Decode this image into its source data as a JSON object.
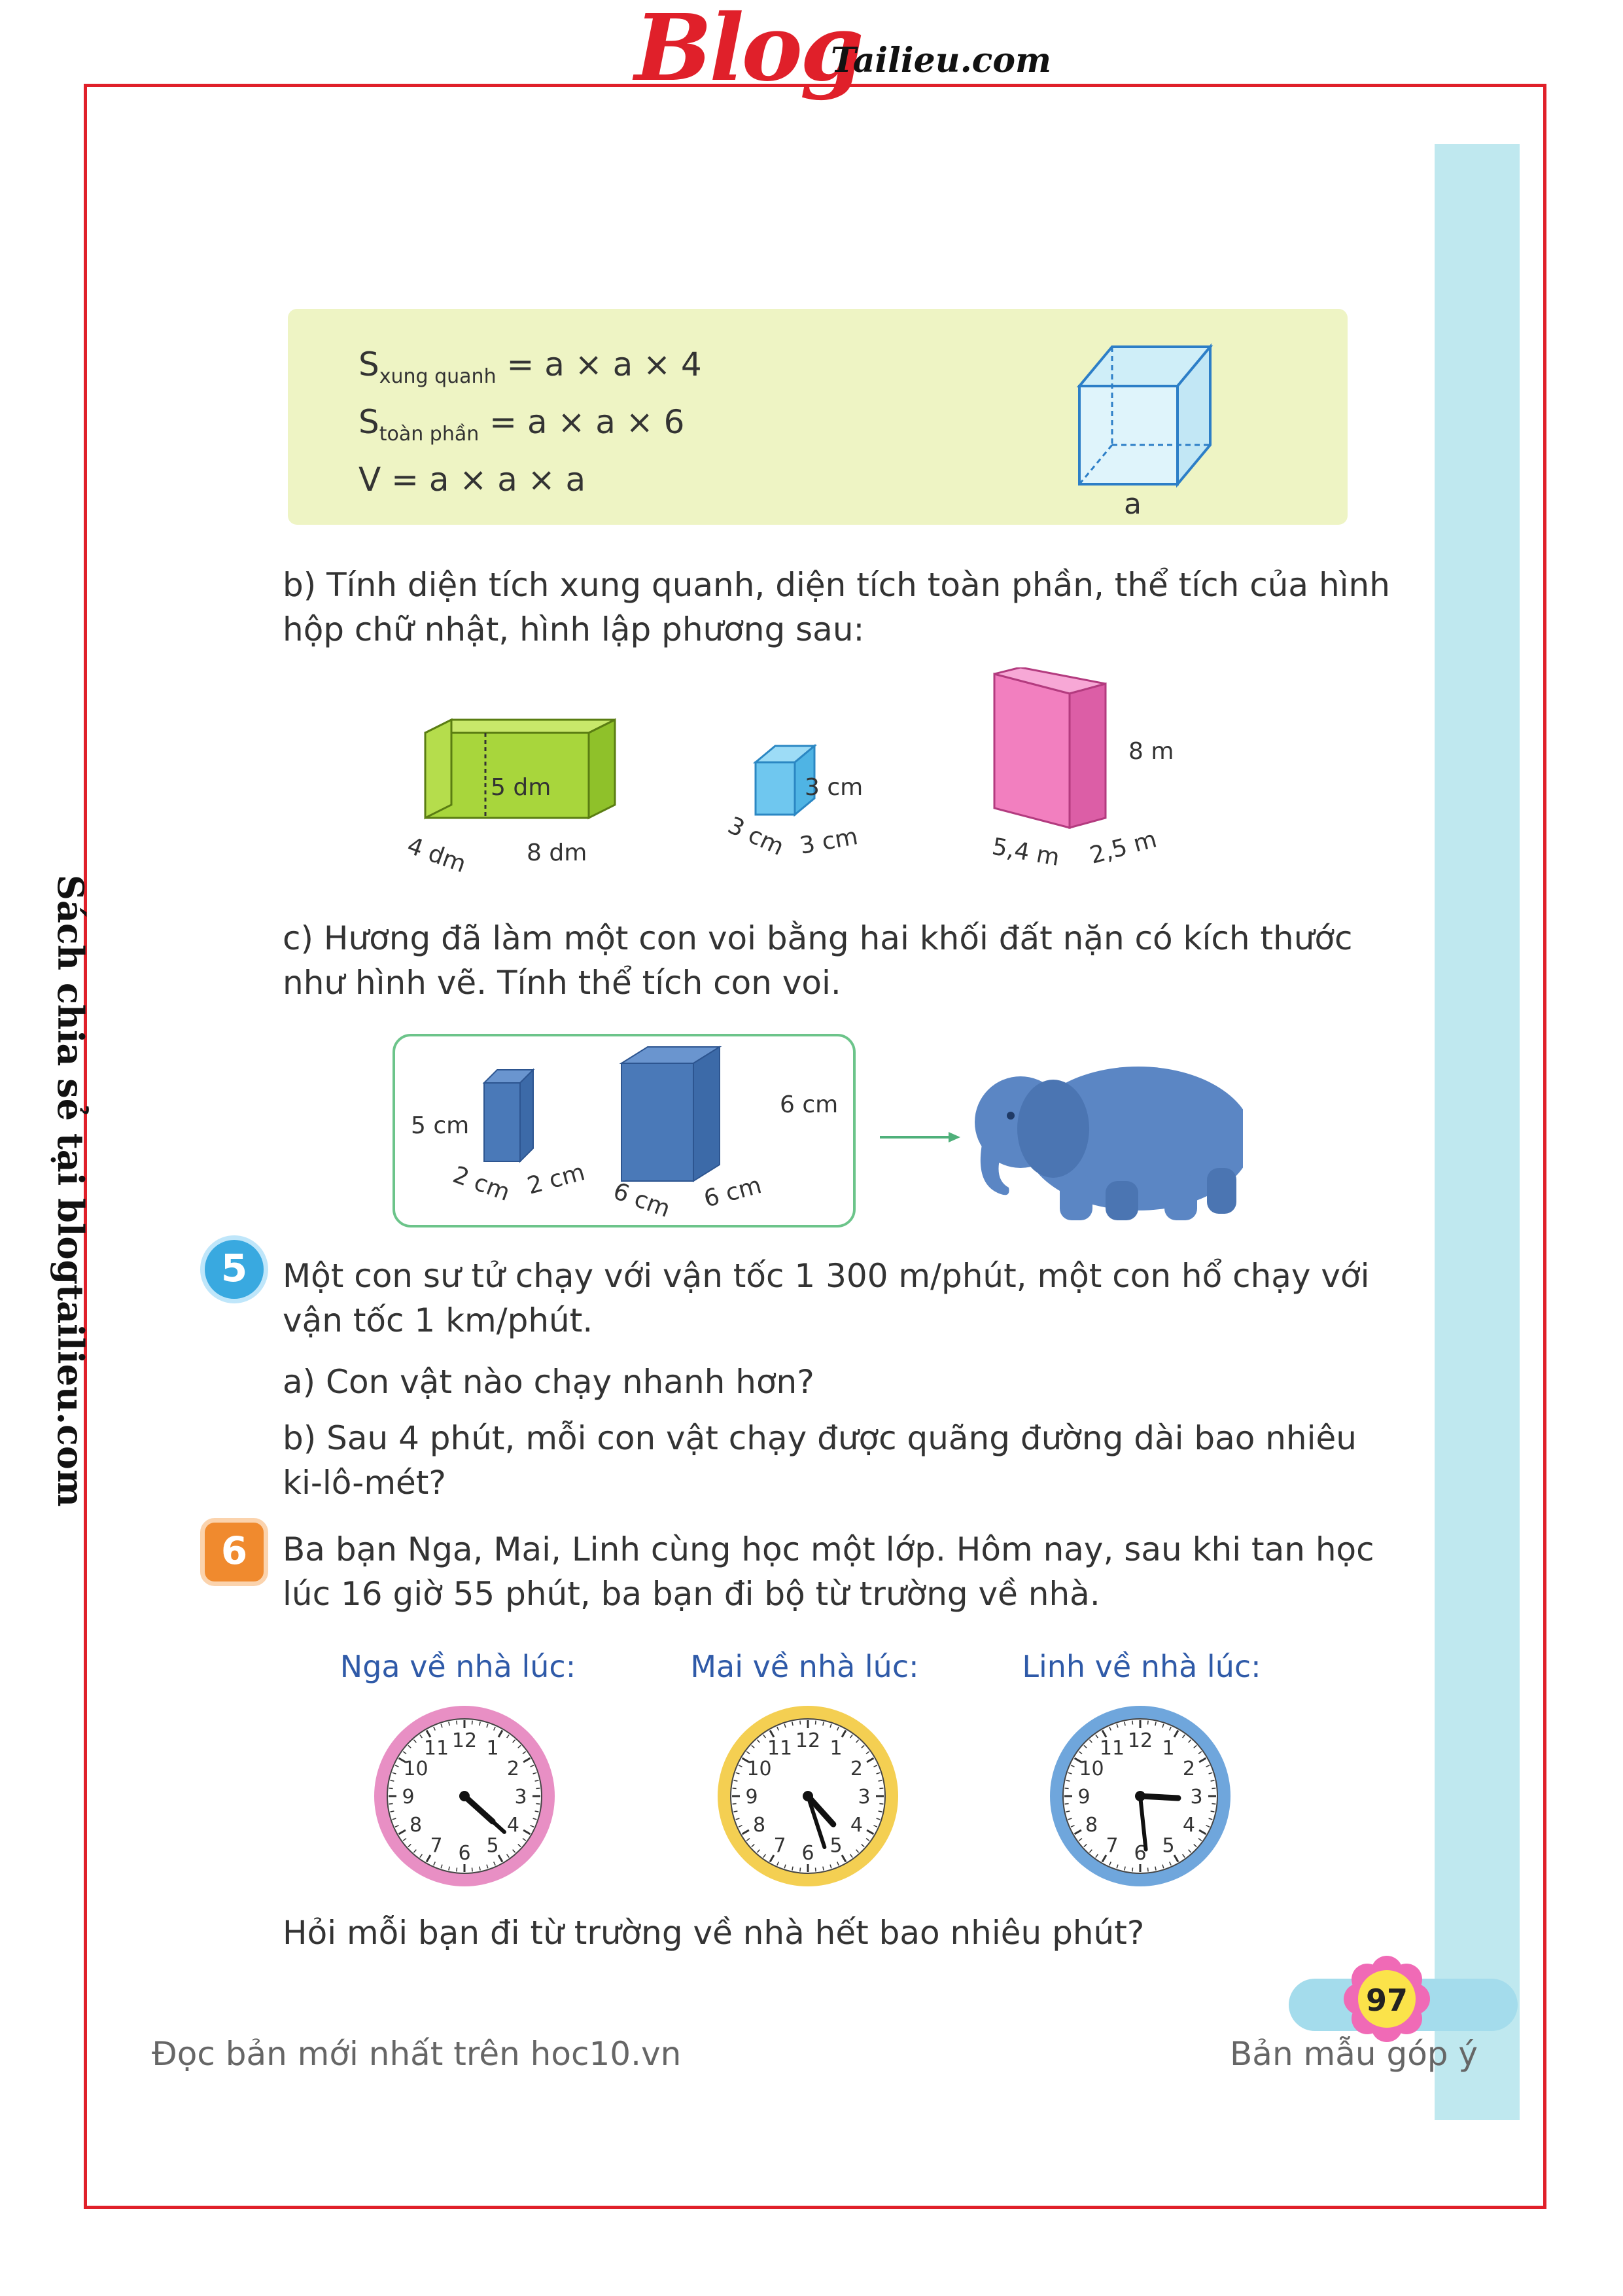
{
  "logo": {
    "main": "Blog",
    "sub": "Tailieu.com"
  },
  "side_text": "Sách chia sẻ tại blogtailieu.com",
  "formulas": {
    "line1_main": "S",
    "line1_sub": "xung quanh",
    "line1_expr": " = a × a × 4",
    "line2_main": "S",
    "line2_sub": "toàn phần",
    "line2_expr": " = a × a × 6",
    "line3": "V = a × a × a",
    "cube_label": "a"
  },
  "part_b": {
    "text": "b) Tính diện tích xung quanh, diện tích toàn phần, thể tích của hình hộp chữ nhật, hình lập phương sau:",
    "box1": {
      "height": "5 dm",
      "depth": "4 dm",
      "length": "8 dm"
    },
    "box2": {
      "height": "3 cm",
      "depth": "3 cm",
      "length": "3 cm"
    },
    "box3": {
      "height": "8 m",
      "depth": "5,4 m",
      "length": "2,5 m"
    }
  },
  "part_c": {
    "text": "c) Hương đã làm một con voi bằng hai khối đất nặn có kích thước như hình vẽ. Tính thể tích con voi.",
    "block1": {
      "height": "5 cm",
      "w1": "2 cm",
      "w2": "2 cm"
    },
    "block2": {
      "height": "6 cm",
      "w1": "6 cm",
      "w2": "6 cm"
    }
  },
  "q5": {
    "number": "5",
    "text": "Một con sư tử chạy với vận tốc 1 300 m/phút, một con hổ chạy với vận tốc 1 km/phút.",
    "a": "a) Con vật nào chạy nhanh hơn?",
    "b": "b) Sau 4 phút, mỗi con vật chạy được quãng đường dài bao nhiêu ki-lô-mét?"
  },
  "q6": {
    "number": "6",
    "text": "Ba bạn Nga, Mai, Linh cùng học một lớp. Hôm nay, sau khi tan học lúc 16 giờ 55 phút, ba bạn đi bộ từ trường về nhà.",
    "question": "Hỏi mỗi bạn đi từ trường về nhà hết bao nhiêu phút?"
  },
  "clocks": [
    {
      "title": "Nga về nhà lúc:",
      "rim": "#e88fc4",
      "hour": 4.4,
      "minute": 22
    },
    {
      "title": "Mai về nhà lúc:",
      "rim": "#f4cf52",
      "hour": 4.6,
      "minute": 27
    },
    {
      "title": "Linh về nhà lúc:",
      "rim": "#6fa6dc",
      "hour": 3.1,
      "minute": 29
    }
  ],
  "clock_numbers": [
    "12",
    "1",
    "2",
    "3",
    "4",
    "5",
    "6",
    "7",
    "8",
    "9",
    "10",
    "11"
  ],
  "footer": {
    "left": "Đọc bản mới nhất trên hoc10.vn",
    "right": "Bản mẫu góp ý",
    "page": "97"
  },
  "colors": {
    "frame": "#e0202a",
    "sidebar": "#bfe8ef",
    "formula_bg": "#eef4c4",
    "q5_circle": "#39a9e0",
    "q6_circle": "#f08a2e"
  }
}
